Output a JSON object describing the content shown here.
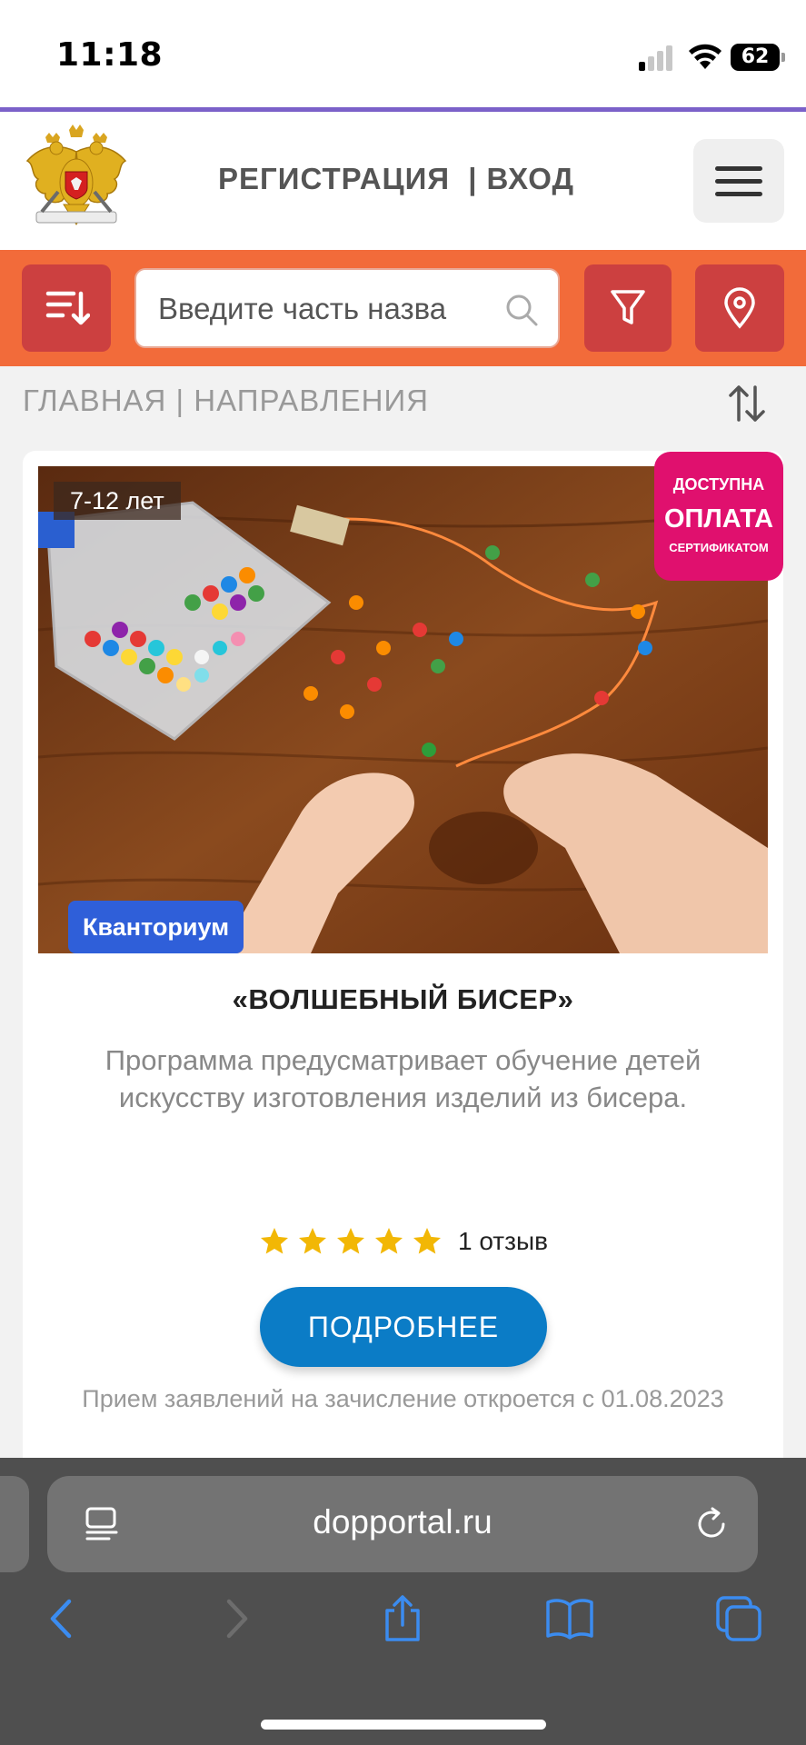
{
  "status_bar": {
    "time": "11:18",
    "battery": "62"
  },
  "header": {
    "register_label": "РЕГИСТРАЦИЯ",
    "separator": "|",
    "login_label": "ВХОД"
  },
  "search": {
    "placeholder": "Введите часть назва"
  },
  "breadcrumb": {
    "home": "ГЛАВНАЯ",
    "separator": "|",
    "section": "НАПРАВЛЕНИЯ"
  },
  "card": {
    "age": "7-12 лет",
    "cert_line1": "ДОСТУПНА",
    "cert_line2": "ОПЛАТА",
    "cert_line3": "СЕРТИФИКАТОМ",
    "organization": "Кванториум",
    "title": "«ВОЛШЕБНЫЙ БИСЕР»",
    "description": "Программа предусматривает обучение детей искусству изготовления изделий из бисера.",
    "rating_stars": 5,
    "reviews": "1 отзыв",
    "more_button": "ПОДРОБНЕЕ",
    "admission": "Прием заявлений на зачисление откроется с 01.08.2023"
  },
  "browser": {
    "url": "dopportal.ru"
  },
  "colors": {
    "toolbar": "#f26b3a",
    "toolbar_button": "#cc4040",
    "cert_badge": "#e0106e",
    "org_badge": "#2f5fd9",
    "more_button": "#0b7cc6",
    "star": "#f2b705"
  }
}
